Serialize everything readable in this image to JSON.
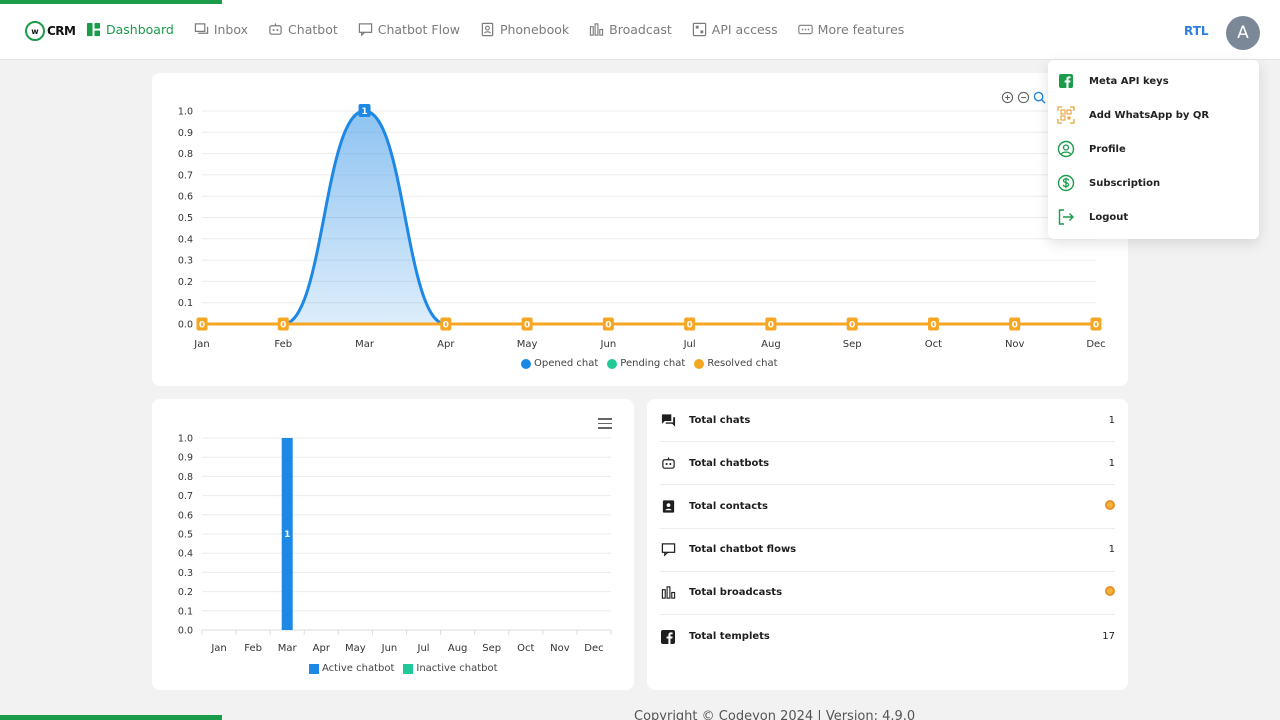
{
  "app": {
    "logo_text": "CRM",
    "logo_mark": "w"
  },
  "nav": {
    "items": [
      {
        "label": "Dashboard",
        "icon": "dashboard-icon",
        "active": true
      },
      {
        "label": "Inbox",
        "icon": "inbox-icon",
        "active": false
      },
      {
        "label": "Chatbot",
        "icon": "robot-icon",
        "active": false
      },
      {
        "label": "Chatbot Flow",
        "icon": "flow-icon",
        "active": false
      },
      {
        "label": "Phonebook",
        "icon": "phonebook-icon",
        "active": false
      },
      {
        "label": "Broadcast",
        "icon": "broadcast-icon",
        "active": false
      },
      {
        "label": "API access",
        "icon": "api-icon",
        "active": false
      },
      {
        "label": "More features",
        "icon": "more-icon",
        "active": false
      }
    ],
    "rtl_label": "RTL",
    "avatar_letter": "A"
  },
  "dropdown": {
    "items": [
      {
        "label": "Meta API keys",
        "icon": "facebook-icon"
      },
      {
        "label": "Add WhatsApp by QR",
        "icon": "qr-icon"
      },
      {
        "label": "Profile",
        "icon": "user-circle-icon"
      },
      {
        "label": "Subscription",
        "icon": "dollar-icon"
      },
      {
        "label": "Logout",
        "icon": "logout-icon"
      }
    ]
  },
  "chart_data": [
    {
      "type": "area",
      "categories": [
        "Jan",
        "Feb",
        "Mar",
        "Apr",
        "May",
        "Jun",
        "Jul",
        "Aug",
        "Sep",
        "Oct",
        "Nov",
        "Dec"
      ],
      "series": [
        {
          "name": "Opened chat",
          "values": [
            0,
            0,
            1,
            0,
            0,
            0,
            0,
            0,
            0,
            0,
            0,
            0
          ],
          "color": "#1e88e5"
        },
        {
          "name": "Pending chat",
          "values": [
            0,
            0,
            0,
            0,
            0,
            0,
            0,
            0,
            0,
            0,
            0,
            0
          ],
          "color": "#20c997"
        },
        {
          "name": "Resolved chat",
          "values": [
            0,
            0,
            0,
            0,
            0,
            0,
            0,
            0,
            0,
            0,
            0,
            0
          ],
          "color": "#f6a623"
        }
      ],
      "ylim": [
        0,
        1
      ],
      "yticks": [
        "0.0",
        "0.1",
        "0.2",
        "0.3",
        "0.4",
        "0.5",
        "0.6",
        "0.7",
        "0.8",
        "0.9",
        "1.0"
      ],
      "legend": "bottom",
      "grid": true
    },
    {
      "type": "bar",
      "categories": [
        "Jan",
        "Feb",
        "Mar",
        "Apr",
        "May",
        "Jun",
        "Jul",
        "Aug",
        "Sep",
        "Oct",
        "Nov",
        "Dec"
      ],
      "series": [
        {
          "name": "Active chatbot",
          "values": [
            0,
            0,
            1,
            0,
            0,
            0,
            0,
            0,
            0,
            0,
            0,
            0
          ],
          "color": "#1e88e5"
        },
        {
          "name": "Inactive chatbot",
          "values": [
            0,
            0,
            0,
            0,
            0,
            0,
            0,
            0,
            0,
            0,
            0,
            0
          ],
          "color": "#20c997"
        }
      ],
      "ylim": [
        0,
        1
      ],
      "yticks": [
        "0.0",
        "0.1",
        "0.2",
        "0.3",
        "0.4",
        "0.5",
        "0.6",
        "0.7",
        "0.8",
        "0.9",
        "1.0"
      ],
      "legend": "bottom",
      "grid": true
    }
  ],
  "stats": [
    {
      "label": "Total chats",
      "value": "1",
      "icon": "chat-icon",
      "loading": false
    },
    {
      "label": "Total chatbots",
      "value": "1",
      "icon": "robot-icon",
      "loading": false
    },
    {
      "label": "Total contacts",
      "value": "",
      "icon": "contacts-icon",
      "loading": true
    },
    {
      "label": "Total chatbot flows",
      "value": "1",
      "icon": "flow-icon",
      "loading": false
    },
    {
      "label": "Total broadcasts",
      "value": "",
      "icon": "broadcast-icon",
      "loading": true
    },
    {
      "label": "Total templets",
      "value": "17",
      "icon": "facebook-icon",
      "loading": false
    }
  ],
  "footer": {
    "text": "Copyright © Codeyon 2024 | Version: 4.9.0"
  },
  "colors": {
    "brand": "#1a9c4a",
    "accent_blue": "#2b7fe0"
  }
}
